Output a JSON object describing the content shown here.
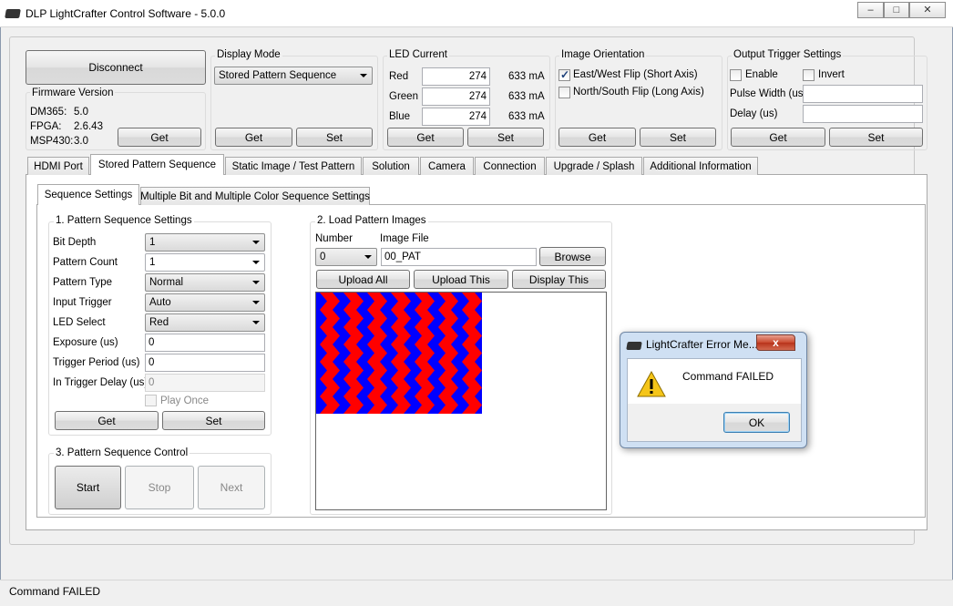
{
  "window": {
    "title": "DLP LightCrafter Control Software - 5.0.0",
    "minimize": "–",
    "maximize": "□",
    "close": "✕"
  },
  "connection": {
    "disconnect_label": "Disconnect"
  },
  "firmware": {
    "title": "Firmware Version",
    "dm365_label": "DM365:",
    "dm365_value": "5.0",
    "fpga_label": "FPGA:",
    "fpga_value": "2.6.43",
    "msp430_label": "MSP430:",
    "msp430_value": "3.0",
    "get_label": "Get"
  },
  "display_mode": {
    "title": "Display Mode",
    "selected": "Stored Pattern Sequence",
    "get_label": "Get",
    "set_label": "Set"
  },
  "led_current": {
    "title": "LED Current",
    "red_label": "Red",
    "red_value": "274",
    "red_ma": "633 mA",
    "green_label": "Green",
    "green_value": "274",
    "green_ma": "633 mA",
    "blue_label": "Blue",
    "blue_value": "274",
    "blue_ma": "633 mA",
    "get_label": "Get",
    "set_label": "Set"
  },
  "orientation": {
    "title": "Image Orientation",
    "east_west_label": "East/West Flip (Short Axis)",
    "east_west_checked": true,
    "north_south_label": "North/South Flip (Long Axis)",
    "north_south_checked": false,
    "get_label": "Get",
    "set_label": "Set"
  },
  "trigger": {
    "title": "Output Trigger Settings",
    "enable_label": "Enable",
    "invert_label": "Invert",
    "pulse_width_label": "Pulse Width (us)",
    "pulse_width_value": "",
    "delay_label": "Delay (us)",
    "delay_value": "",
    "get_label": "Get",
    "set_label": "Set"
  },
  "main_tabs": [
    "HDMI Port",
    "Stored Pattern Sequence",
    "Static Image / Test Pattern",
    "Solution",
    "Camera",
    "Connection",
    "Upgrade / Splash",
    "Additional Information"
  ],
  "sub_tabs": [
    "Sequence Settings",
    "Multiple Bit and Multiple Color Sequence Settings"
  ],
  "pattern_settings": {
    "title": "1. Pattern Sequence Settings",
    "bit_depth_label": "Bit Depth",
    "bit_depth_value": "1",
    "pattern_count_label": "Pattern Count",
    "pattern_count_value": "1",
    "pattern_type_label": "Pattern Type",
    "pattern_type_value": "Normal",
    "input_trigger_label": "Input Trigger",
    "input_trigger_value": "Auto",
    "led_select_label": "LED Select",
    "led_select_value": "Red",
    "exposure_label": "Exposure (us)",
    "exposure_value": "0",
    "trigger_period_label": "Trigger Period (us)",
    "trigger_period_value": "0",
    "in_trigger_delay_label": "In Trigger Delay (us)",
    "in_trigger_delay_value": "0",
    "play_once_label": "Play Once",
    "get_label": "Get",
    "set_label": "Set"
  },
  "pattern_control": {
    "title": "3. Pattern Sequence Control",
    "start_label": "Start",
    "stop_label": "Stop",
    "next_label": "Next"
  },
  "load_images": {
    "title": "2. Load Pattern Images",
    "number_label": "Number",
    "number_value": "0",
    "image_file_label": "Image File",
    "image_file_value": "00_PAT",
    "browse_label": "Browse",
    "upload_all_label": "Upload All",
    "upload_this_label": "Upload This",
    "display_this_label": "Display This"
  },
  "dialog": {
    "title": "LightCrafter Error Me...",
    "message": "Command FAILED",
    "ok_label": "OK",
    "close_label": "x"
  },
  "status_bar": {
    "text": "Command FAILED"
  },
  "colors": {
    "pattern_red": "#ff0000",
    "pattern_blue": "#0000ff",
    "accent": "#3399ff"
  }
}
